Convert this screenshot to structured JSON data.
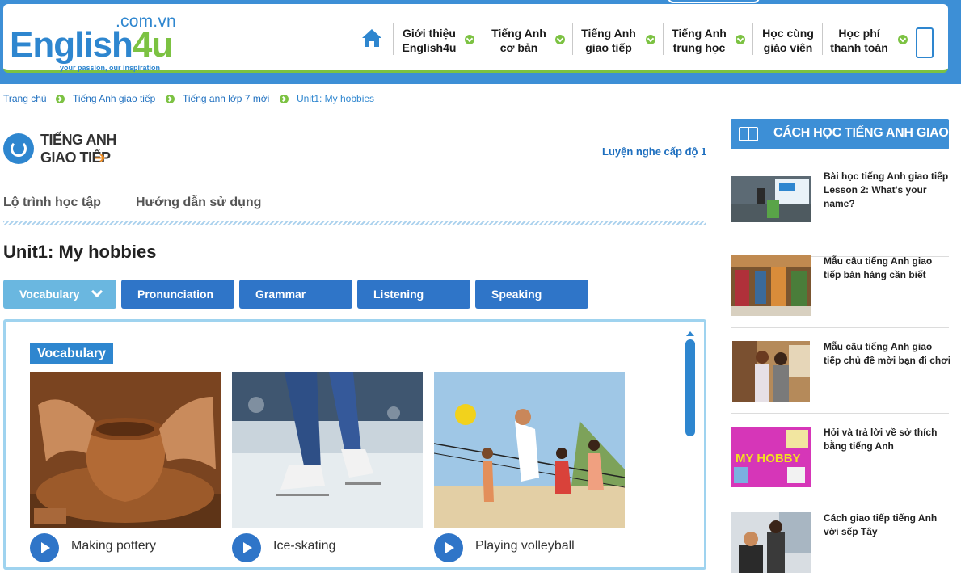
{
  "header": {
    "logo": {
      "domain": ".com.vn",
      "brand_main": "English",
      "brand_num": "4u",
      "tagline": "your passion, our inspiration"
    },
    "home_icon": "home-icon",
    "nav": [
      {
        "label": "Giới thiệu\nEnglish4u"
      },
      {
        "label": "Tiếng Anh\ncơ bản"
      },
      {
        "label": "Tiếng Anh\ngiao tiếp"
      },
      {
        "label": "Tiếng Anh\ntrung học"
      },
      {
        "label": "Học cùng\ngiáo viên"
      },
      {
        "label": "Học phí\nthanh toán"
      }
    ],
    "device_icon": "mobile-phone-icon"
  },
  "breadcrumb": [
    "Trang chủ",
    "Tiếng Anh giao tiếp",
    "Tiếng anh lớp 7 mới",
    "Unit1: My hobbies"
  ],
  "section": {
    "logo_line1": "TIẾNG ANH",
    "logo_line2": "GIAO TIẾP",
    "arrow": "➔",
    "level_link": "Luyện nghe cấp độ 1",
    "subtabs": [
      "Lộ trình học tập",
      "Hướng dẫn sử dụng"
    ]
  },
  "unit_title": "Unit1: My hobbies",
  "tabs": [
    {
      "label": "Vocabulary",
      "active": true
    },
    {
      "label": "Pronunciation"
    },
    {
      "label": "Grammar"
    },
    {
      "label": "Listening"
    },
    {
      "label": "Speaking"
    }
  ],
  "panel": {
    "label": "Vocabulary",
    "cards": [
      {
        "caption": "Making pottery"
      },
      {
        "caption": "Ice-skating"
      },
      {
        "caption": "Playing volleyball"
      }
    ]
  },
  "sidebar": {
    "title": "CÁCH HỌC TIẾNG ANH GIAO TIẾP",
    "items": [
      {
        "title": "Bài học tiếng Anh giao tiếp Lesson 2: What's your name?"
      },
      {
        "title": "Mẫu câu tiếng Anh giao tiếp bán hàng cần biết"
      },
      {
        "title": "Mẫu câu tiếng Anh giao tiếp chủ đề mời bạn đi chơi"
      },
      {
        "title": "Hỏi và trả lời về sở thích bằng tiếng Anh",
        "thumb_text": "MY HOBBY"
      },
      {
        "title": "Cách giao tiếp tiếng Anh với sếp Tây"
      }
    ]
  },
  "colors": {
    "brand_blue": "#2e86cf",
    "brand_green": "#7cc242",
    "tab_blue": "#2f75c8",
    "tab_active": "#6ab7e0",
    "accent_orange": "#f08a1c"
  }
}
